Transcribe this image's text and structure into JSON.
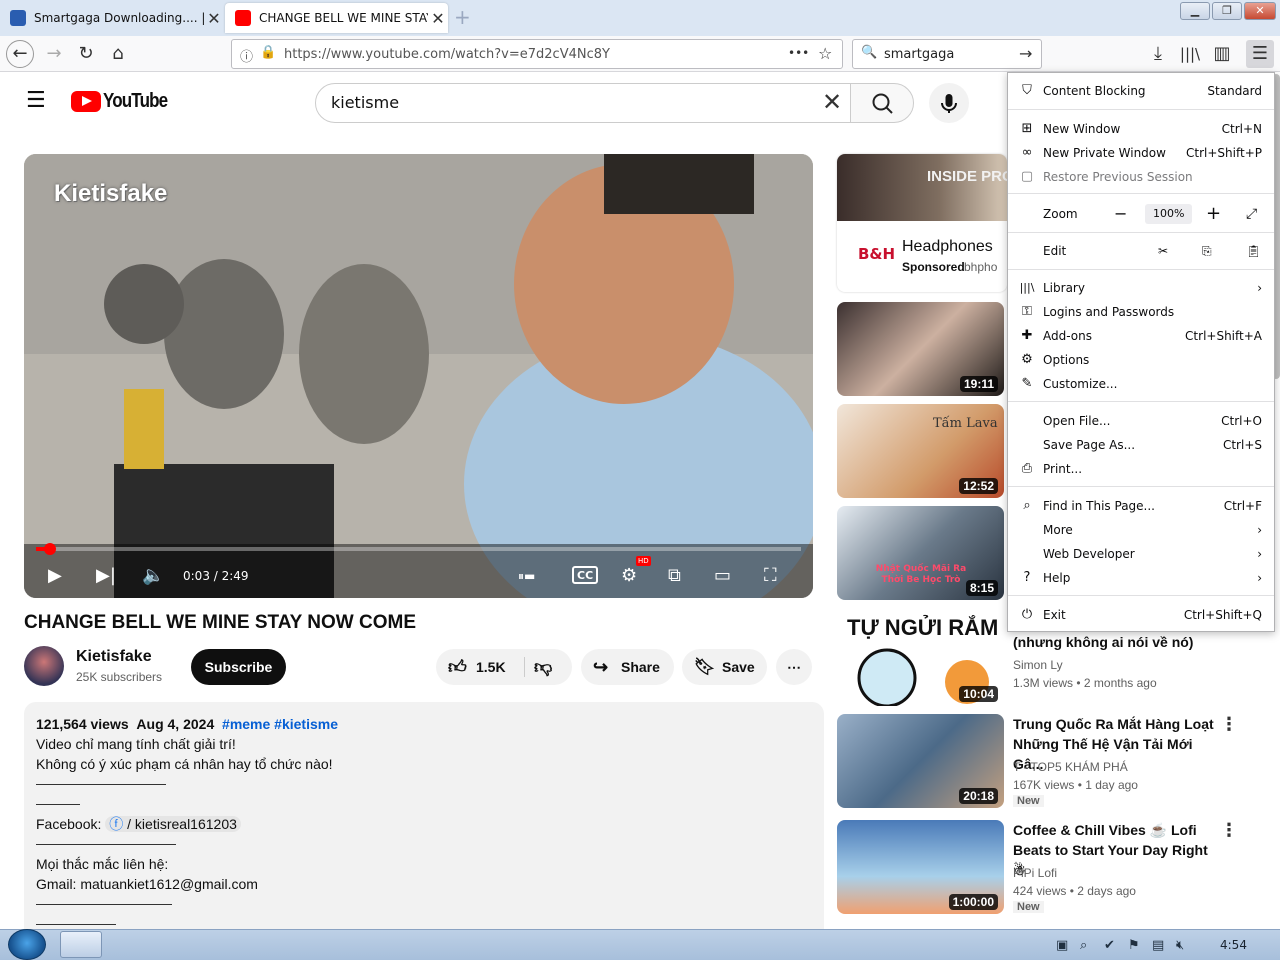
{
  "tabs": [
    {
      "title": "Smartgaga Downloading.... | S",
      "close": "✕"
    },
    {
      "title": "CHANGE BELL WE MINE STAY",
      "close": "✕"
    }
  ],
  "new_tab": "+",
  "nav": {
    "url": "https://www.youtube.com/watch?v=e7d2cV4Nc8Y",
    "url_more": "•••",
    "search_value": "smartgaga"
  },
  "youtube": {
    "logo_text": "YouTube",
    "search_value": "kietisme",
    "player": {
      "overlay_title": "Kietisfake",
      "time": "0:03 / 2:49",
      "progress": 0.018,
      "cc": "CC",
      "hd": "HD"
    },
    "video_title": "CHANGE BELL WE MINE STAY NOW COME",
    "channel": {
      "name": "Kietisfake",
      "subs": "25K subscribers",
      "subscribe": "Subscribe"
    },
    "likes": "1.5K",
    "share": "Share",
    "save": "Save",
    "description": {
      "views": "121,564 views",
      "date": "Aug 4, 2024",
      "tags": "#meme #kietisme",
      "line1": "Video chỉ mang tính chất giải trí!",
      "line2": "Không có ý xúc phạm cá nhân hay tổ chức nào!",
      "facebook_label": "Facebook:",
      "facebook_link": "/ kietisreal161203",
      "contact": "Mọi thắc mắc liên hệ:",
      "gmail": "Gmail: matuankiet1612@gmail.com"
    },
    "ad": {
      "title": "Headphones",
      "sponsored": "Sponsored",
      "domain": "bhpho",
      "logo": "B&H",
      "thumb_text": "INSIDE PROD"
    },
    "sidebar": [
      {
        "duration": "19:11"
      },
      {
        "duration": "12:52",
        "thumb_text": "Tấm Lava"
      },
      {
        "duration": "8:15",
        "thumb_text": "Nhật Quốc Mãi Ra Thời Be Học Trò"
      },
      {
        "duration": "10:04",
        "thumb_text": "TỰ NGỬI RẮM",
        "title": "(nhưng không ai nói về nó)",
        "channel": "Simon Ly",
        "views": "1.3M views",
        "age": "2 months ago"
      },
      {
        "duration": "20:18",
        "title": "Trung Quốc Ra Mắt Hàng Loạt Những Thế Hệ Vận Tải Mới Gâ...",
        "channel": "T - TOP5 KHÁM PHÁ",
        "views": "167K views",
        "age": "1 day ago",
        "badge": "New"
      },
      {
        "duration": "1:00:00",
        "title": "Coffee & Chill Vibes ☕ Lofi Beats to Start Your Day Right ☃",
        "channel": "PiPi Lofi",
        "views": "424 views",
        "age": "2 days ago",
        "badge": "New"
      }
    ]
  },
  "menu": {
    "content_blocking": {
      "label": "Content Blocking",
      "value": "Standard"
    },
    "new_window": {
      "label": "New Window",
      "shortcut": "Ctrl+N"
    },
    "private_window": {
      "label": "New Private Window",
      "shortcut": "Ctrl+Shift+P"
    },
    "restore": {
      "label": "Restore Previous Session"
    },
    "zoom": {
      "label": "Zoom",
      "value": "100%"
    },
    "edit": {
      "label": "Edit"
    },
    "library": {
      "label": "Library"
    },
    "logins": {
      "label": "Logins and Passwords"
    },
    "addons": {
      "label": "Add-ons",
      "shortcut": "Ctrl+Shift+A"
    },
    "options": {
      "label": "Options"
    },
    "customize": {
      "label": "Customize..."
    },
    "open_file": {
      "label": "Open File...",
      "shortcut": "Ctrl+O"
    },
    "save_page": {
      "label": "Save Page As...",
      "shortcut": "Ctrl+S"
    },
    "print": {
      "label": "Print..."
    },
    "find": {
      "label": "Find in This Page...",
      "shortcut": "Ctrl+F"
    },
    "more": {
      "label": "More"
    },
    "web_dev": {
      "label": "Web Developer"
    },
    "help": {
      "label": "Help"
    },
    "exit": {
      "label": "Exit",
      "shortcut": "Ctrl+Shift+Q"
    }
  },
  "taskbar": {
    "clock": "4:54"
  }
}
